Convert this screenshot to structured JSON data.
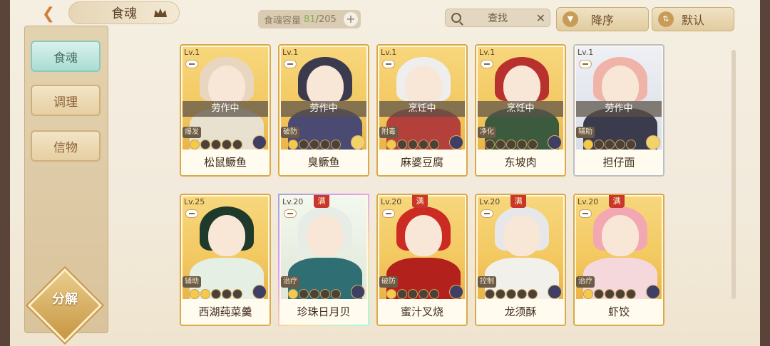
{
  "header": {
    "title": "食魂",
    "capacity_label": "食魂容量",
    "capacity_current": "81",
    "capacity_total": "/205",
    "search_label": "查找",
    "sort_label": "降序",
    "default_label": "默认"
  },
  "sidebar": {
    "tabs": [
      {
        "label": "食魂",
        "active": true
      },
      {
        "label": "调理",
        "active": false
      },
      {
        "label": "信物",
        "active": false
      }
    ],
    "decompose_label": "分解"
  },
  "cards": [
    {
      "lv": "Lv.1",
      "status": "劳作中",
      "role": "爆发",
      "stars_on": 1,
      "element": "dark",
      "name": "松鼠鳜鱼",
      "frame": "gold",
      "hair": "#e9d6c0",
      "body": "#e8e1cf"
    },
    {
      "lv": "Lv.1",
      "status": "劳作中",
      "role": "破防",
      "stars_on": 1,
      "element": "light",
      "name": "臭鳜鱼",
      "frame": "gold",
      "hair": "#3c3a4d",
      "body": "#4a4a73"
    },
    {
      "lv": "Lv.1",
      "status": "烹饪中",
      "role": "附毒",
      "stars_on": 1,
      "element": "dark",
      "name": "麻婆豆腐",
      "frame": "gold",
      "hair": "#eeeeee",
      "body": "#b3403b"
    },
    {
      "lv": "Lv.1",
      "status": "烹饪中",
      "role": "净化",
      "stars_on": 0,
      "element": "dark",
      "name": "东坡肉",
      "frame": "gold",
      "hair": "#b9312e",
      "body": "#3c5a3e"
    },
    {
      "lv": "Lv.1",
      "status": "劳作中",
      "role": "辅助",
      "stars_on": 1,
      "element": "light",
      "name": "担仔面",
      "frame": "silver",
      "hair": "#f0b3a7",
      "body": "#3b3b4e"
    },
    {
      "lv": "Lv.25",
      "status": "",
      "role": "辅助",
      "stars_on": 2,
      "element": "dark",
      "name": "西湖莼菜羹",
      "frame": "gold",
      "hair": "#1f3a2b",
      "body": "#e5efe3"
    },
    {
      "lv": "Lv.20",
      "status": "",
      "role": "治疗",
      "stars_on": 1,
      "element": "dark",
      "name": "珍珠日月贝",
      "frame": "rainbow",
      "full": "满",
      "hair": "#e8ece6",
      "body": "#2f6e72"
    },
    {
      "lv": "Lv.20",
      "status": "",
      "role": "破防",
      "stars_on": 1,
      "element": "dark",
      "name": "蜜汁叉烧",
      "frame": "gold",
      "full": "满",
      "hair": "#cc2b24",
      "body": "#b3211c"
    },
    {
      "lv": "Lv.20",
      "status": "",
      "role": "控制",
      "stars_on": 0,
      "element": "dark",
      "name": "龙须酥",
      "frame": "gold",
      "full": "满",
      "hair": "#e7e7ea",
      "body": "#f2f0ea"
    },
    {
      "lv": "Lv.20",
      "status": "",
      "role": "治疗",
      "stars_on": 1,
      "element": "dark",
      "name": "虾饺",
      "frame": "gold",
      "full": "满",
      "hair": "#f2a8b3",
      "body": "#f5d8dc"
    }
  ]
}
